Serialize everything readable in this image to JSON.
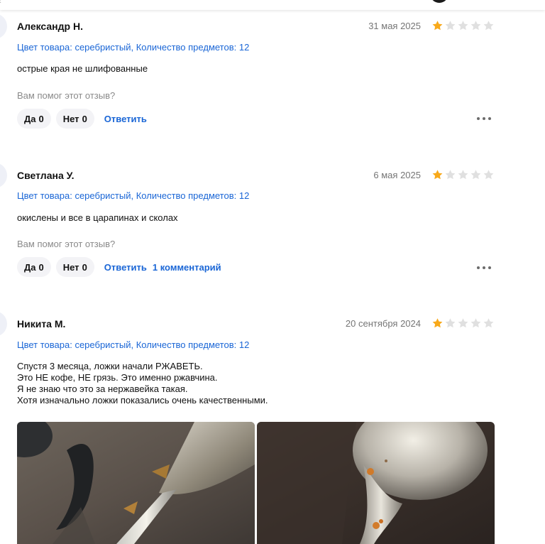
{
  "reviews": [
    {
      "author": "Александр Н.",
      "date": "31 мая 2025",
      "rating": 1,
      "params": "Цвет товара: серебристый, Количество предметов: 12",
      "text": "острые края не шлифованные",
      "helpful": "Вам помог этот отзыв?",
      "yes_label": "Да",
      "yes_count": "0",
      "no_label": "Нет",
      "no_count": "0",
      "reply": "Ответить"
    },
    {
      "author": "Светлана У.",
      "date": "6 мая 2025",
      "rating": 1,
      "params": "Цвет товара: серебристый, Количество предметов: 12",
      "text": "окислены и все в царапинах и сколах",
      "helpful": "Вам помог этот отзыв?",
      "yes_label": "Да",
      "yes_count": "0",
      "no_label": "Нет",
      "no_count": "0",
      "reply": "Ответить",
      "comments": "1 комментарий"
    },
    {
      "author": "Никита М.",
      "date": "20 сентября 2024",
      "rating": 1,
      "params": "Цвет товара: серебристый, Количество предметов: 12",
      "text": "Спустя 3 месяца, ложки начали РЖАВЕТЬ.\nЭто НЕ кофе, НЕ грязь. Это именно ржавчина.\nЯ не знаю что это за нержавейка такая.\nХотя изначально ложки показались очень качественными.",
      "photos": [
        "photo-spoon-handle-rust",
        "photo-spoon-neck-rust"
      ]
    }
  ],
  "colors": {
    "star_filled": "#f8a91a",
    "star_empty": "#e0e0e0",
    "link": "#1a66d6",
    "muted": "#757575"
  },
  "icons": [
    "star-icon",
    "more-dots-icon"
  ]
}
